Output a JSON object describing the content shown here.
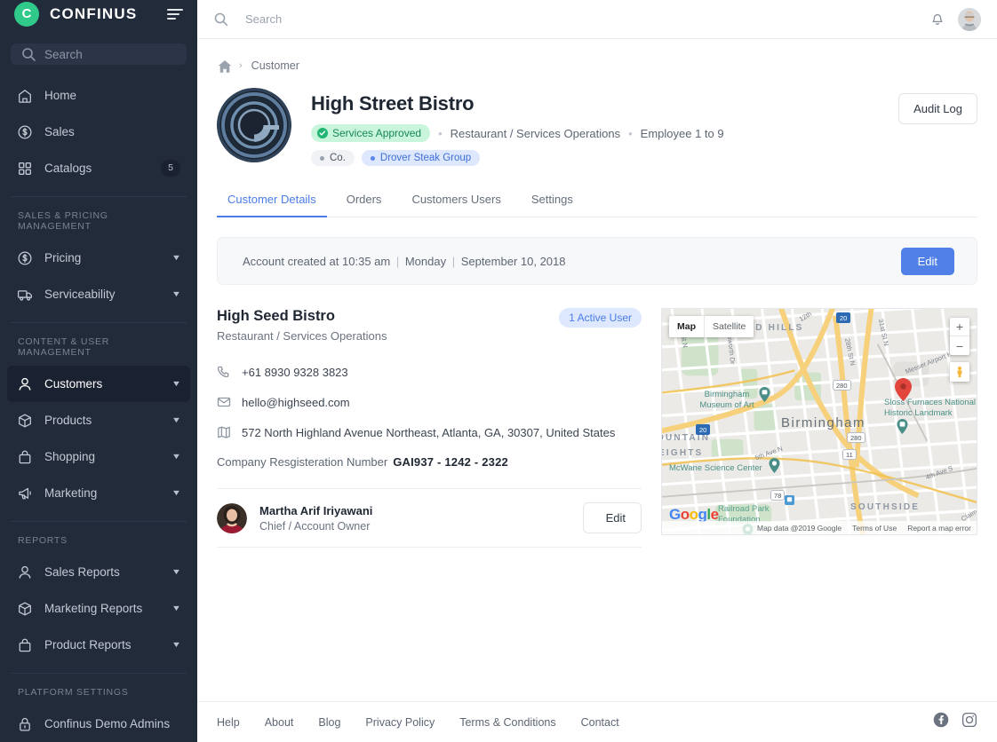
{
  "brand": {
    "logo_letter": "C",
    "name": "CONFINUS",
    "logo_color": "#2fc98a"
  },
  "sidebar": {
    "search_placeholder": "Search",
    "primary": [
      {
        "label": "Home",
        "icon": "home-icon",
        "caret": false,
        "badge": null
      },
      {
        "label": "Sales",
        "icon": "dollar-circle-icon",
        "caret": false,
        "badge": null
      },
      {
        "label": "Catalogs",
        "icon": "grid-icon",
        "caret": false,
        "badge": "5"
      }
    ],
    "sections": [
      {
        "heading": "SALES & PRICING MANAGEMENT",
        "items": [
          {
            "label": "Pricing",
            "icon": "dollar-circle-icon",
            "caret": true,
            "active": false
          },
          {
            "label": "Serviceability",
            "icon": "truck-icon",
            "caret": true,
            "active": false
          }
        ]
      },
      {
        "heading": "CONTENT & USER MANAGEMENT",
        "items": [
          {
            "label": "Customers",
            "icon": "user-icon",
            "caret": true,
            "active": true
          },
          {
            "label": "Products",
            "icon": "box-icon",
            "caret": true,
            "active": false
          },
          {
            "label": "Shopping",
            "icon": "bag-icon",
            "caret": true,
            "active": false
          },
          {
            "label": "Marketing",
            "icon": "megaphone-icon",
            "caret": true,
            "active": false
          }
        ]
      },
      {
        "heading": "REPORTS",
        "items": [
          {
            "label": "Sales Reports",
            "icon": "user-icon",
            "caret": true,
            "active": false
          },
          {
            "label": "Marketing Reports",
            "icon": "box-icon",
            "caret": true,
            "active": false
          },
          {
            "label": "Product Reports",
            "icon": "bag-icon",
            "caret": true,
            "active": false
          }
        ]
      },
      {
        "heading": "PLATFORM SETTINGS",
        "items": [
          {
            "label": "Confinus Demo Admins",
            "icon": "lock-icon",
            "caret": false,
            "active": false
          }
        ]
      }
    ]
  },
  "topbar": {
    "search_placeholder": "Search",
    "search_value": "",
    "notification_icon": "bell-icon",
    "avatar_name": "user-avatar"
  },
  "breadcrumb": {
    "home_icon": "home-icon",
    "separator": "›",
    "current": "Customer"
  },
  "customer": {
    "logo_name": "customer-logo",
    "title": "High Street Bistro",
    "status_badge": "Services Approved",
    "status_color": "#16875a",
    "status_bg": "#c9f5dd",
    "industry": "Restaurant / Services Operations",
    "employees": "Employee 1 to 9",
    "tags": [
      {
        "label": "Co.",
        "style": "gray"
      },
      {
        "label": "Drover Steak Group",
        "style": "blue"
      }
    ],
    "audit_log_label": "Audit Log"
  },
  "tabs": [
    {
      "label": "Customer Details",
      "active": true
    },
    {
      "label": "Orders",
      "active": false
    },
    {
      "label": "Customers Users",
      "active": false
    },
    {
      "label": "Settings",
      "active": false
    }
  ],
  "account_bar": {
    "prefix": "Account created at 10:35 am",
    "day": "Monday",
    "date": "September 10, 2018",
    "edit_label": "Edit",
    "edit_color": "#5080e8"
  },
  "details": {
    "name": "High Seed Bistro",
    "subtitle": "Restaurant / Services Operations",
    "active_users_badge": "1 Active User",
    "phone": "+61 8930 9328 3823",
    "email": "hello@highseed.com",
    "address": "572 North Highland Avenue Northeast, Atlanta, GA, 30307, United States",
    "reg_label": "Company Resgisteration Number",
    "reg_value": "GAI937 - 1242 - 2322",
    "contact": {
      "avatar_name": "contact-avatar",
      "name": "Martha Arif Iriyawani",
      "role": "Chief / Account Owner",
      "edit_label": "Edit"
    }
  },
  "map": {
    "type_map": "Map",
    "type_satellite": "Satellite",
    "zoom_in": "+",
    "zoom_out": "−",
    "attribution": "Map data @2019 Google",
    "terms": "Terms of Use",
    "report": "Report a map error",
    "watermark": "Google",
    "labels": {
      "area_druid_hills": "DRUID HILLS",
      "city": "Birmingham",
      "area_fountain": "OUNTAIN",
      "area_heights": "EIGHTS",
      "area_southside": "SOUTHSIDE",
      "poi_museum": "Birmingham\nMuseum of Art",
      "poi_mcwane": "McWane Science Center",
      "poi_railroad": "Railroad Park\nFoundation",
      "poi_sloss": "Sloss Furnaces National\nHistoric Landmark",
      "st_28th": "28th St N",
      "st_31st": "31st St N",
      "st_messer": "Messer Airport H",
      "st_5th": "5th Ave N",
      "st_4th": "4th Ave S",
      "st_12th": "12th",
      "st_sworth": "sworth Dr",
      "st_stn": "St N",
      "st_claim": "Claim",
      "shield_i20a": "20",
      "shield_i20b": "20",
      "shield_280a": "280",
      "shield_280b": "280",
      "shield_11": "11",
      "shield_78": "78"
    }
  },
  "footer": {
    "links": [
      "Help",
      "About",
      "Blog",
      "Privacy Policy",
      "Terms & Conditions",
      "Contact"
    ],
    "social": [
      "facebook-icon",
      "instagram-icon"
    ]
  }
}
